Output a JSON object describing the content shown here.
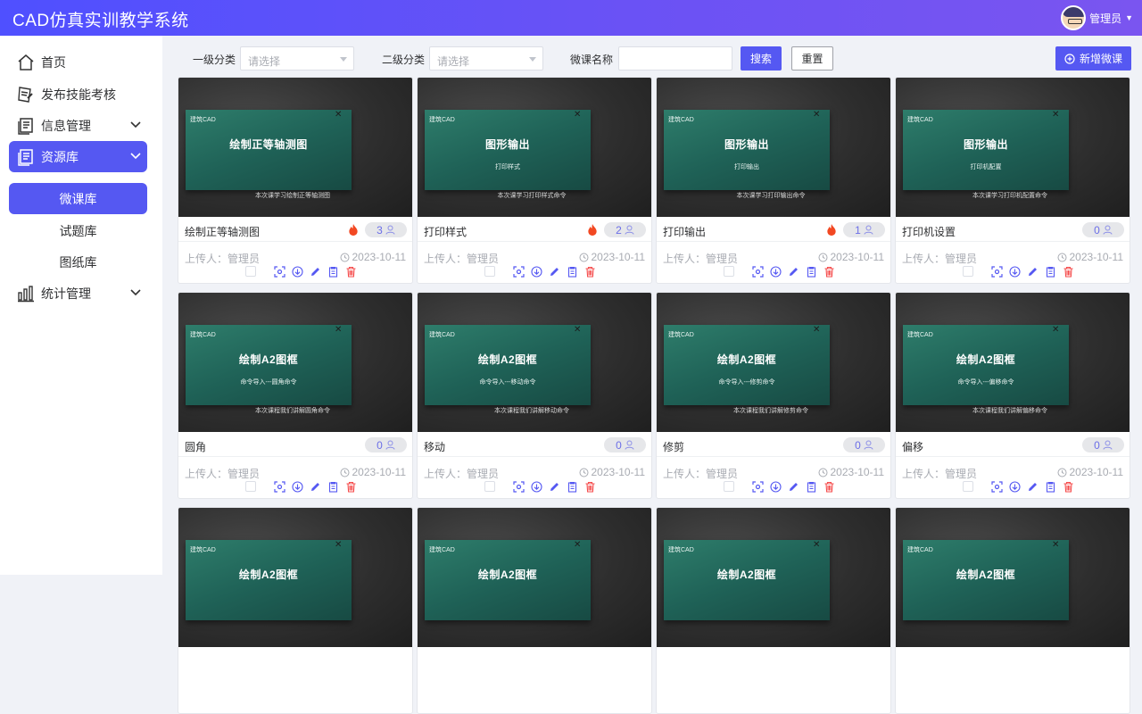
{
  "app": {
    "title": "CAD仿真实训教学系统",
    "user": "管理员"
  },
  "sidebar": {
    "items": [
      {
        "label": "首页",
        "icon": "home-icon"
      },
      {
        "label": "发布技能考核",
        "icon": "assessment-icon"
      },
      {
        "label": "信息管理",
        "icon": "document-icon"
      },
      {
        "label": "资源库",
        "icon": "document-icon"
      },
      {
        "label": "统计管理",
        "icon": "bar-chart-icon"
      }
    ],
    "resource_sub": [
      "微课库",
      "试题库",
      "图纸库"
    ]
  },
  "filters": {
    "level1_label": "一级分类",
    "level1_placeholder": "请选择",
    "level2_label": "二级分类",
    "level2_placeholder": "请选择",
    "name_label": "微课名称",
    "name_value": "",
    "search": "搜索",
    "reset": "重置",
    "add": "新增微课"
  },
  "uploader_prefix": "上传人：",
  "cards": [
    {
      "name": "绘制正等轴测图",
      "views": "3",
      "hot": true,
      "uploader": "管理员",
      "date": "2023-10-11",
      "thumb": {
        "brand": "建筑CAD",
        "title": "绘制正等轴测图",
        "sub": "",
        "note": "本次课学习绘制正等轴测图"
      }
    },
    {
      "name": "打印样式",
      "views": "2",
      "hot": true,
      "uploader": "管理员",
      "date": "2023-10-11",
      "thumb": {
        "brand": "建筑CAD",
        "title": "图形输出",
        "sub": "打印样式",
        "note": "本次课学习打印样式命令"
      }
    },
    {
      "name": "打印输出",
      "views": "1",
      "hot": true,
      "uploader": "管理员",
      "date": "2023-10-11",
      "thumb": {
        "brand": "建筑CAD",
        "title": "图形输出",
        "sub": "打印输出",
        "note": "本次课学习打印输出命令"
      }
    },
    {
      "name": "打印机设置",
      "views": "0",
      "hot": false,
      "uploader": "管理员",
      "date": "2023-10-11",
      "thumb": {
        "brand": "建筑CAD",
        "title": "图形输出",
        "sub": "打印机配置",
        "note": "本次课学习打印机配置命令"
      }
    },
    {
      "name": "圆角",
      "views": "0",
      "hot": false,
      "uploader": "管理员",
      "date": "2023-10-11",
      "thumb": {
        "brand": "建筑CAD",
        "title": "绘制A2图框",
        "sub": "命令导入---圆角命令",
        "note": "本次课程我们讲解圆角命令"
      }
    },
    {
      "name": "移动",
      "views": "0",
      "hot": false,
      "uploader": "管理员",
      "date": "2023-10-11",
      "thumb": {
        "brand": "建筑CAD",
        "title": "绘制A2图框",
        "sub": "命令导入---移动命令",
        "note": "本次课程我们讲解移动命令"
      }
    },
    {
      "name": "修剪",
      "views": "0",
      "hot": false,
      "uploader": "管理员",
      "date": "2023-10-11",
      "thumb": {
        "brand": "建筑CAD",
        "title": "绘制A2图框",
        "sub": "命令导入---修剪命令",
        "note": "本次课程我们讲解修剪命令"
      }
    },
    {
      "name": "偏移",
      "views": "0",
      "hot": false,
      "uploader": "管理员",
      "date": "2023-10-11",
      "thumb": {
        "brand": "建筑CAD",
        "title": "绘制A2图框",
        "sub": "命令导入---偏移命令",
        "note": "本次课程我们讲解偏移命令"
      }
    },
    {
      "name": "",
      "views": "",
      "hot": false,
      "uploader": "",
      "date": "",
      "thumb": {
        "brand": "建筑CAD",
        "title": "绘制A2图框",
        "sub": "",
        "note": ""
      }
    },
    {
      "name": "",
      "views": "",
      "hot": false,
      "uploader": "",
      "date": "",
      "thumb": {
        "brand": "建筑CAD",
        "title": "绘制A2图框",
        "sub": "",
        "note": ""
      }
    },
    {
      "name": "",
      "views": "",
      "hot": false,
      "uploader": "",
      "date": "",
      "thumb": {
        "brand": "建筑CAD",
        "title": "绘制A2图框",
        "sub": "",
        "note": ""
      }
    },
    {
      "name": "",
      "views": "",
      "hot": false,
      "uploader": "",
      "date": "",
      "thumb": {
        "brand": "建筑CAD",
        "title": "绘制A2图框",
        "sub": "",
        "note": ""
      }
    }
  ]
}
